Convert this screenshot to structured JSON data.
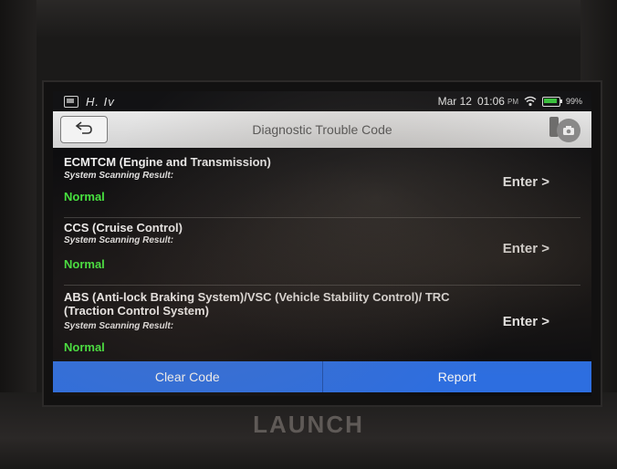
{
  "status_bar": {
    "handwriting": "H. Iv",
    "date": "Mar 12",
    "time": "01:06",
    "ampm": "PM",
    "battery": "99%"
  },
  "header": {
    "title": "Diagnostic Trouble Code"
  },
  "systems": [
    {
      "title": "ECMTCM (Engine and Transmission)",
      "subtitle": "System Scanning Result:",
      "status": "Normal",
      "action": "Enter >"
    },
    {
      "title": "CCS (Cruise Control)",
      "subtitle": "System Scanning Result:",
      "status": "Normal",
      "action": "Enter >"
    },
    {
      "title": "ABS (Anti-lock Braking System)/VSC (Vehicle Stability Control)/ TRC (Traction Control System)",
      "subtitle": "System Scanning Result:",
      "status": "Normal",
      "action": "Enter >"
    }
  ],
  "footer": {
    "clear_code": "Clear Code",
    "report": "Report"
  },
  "device": {
    "brand": "LAUNCH"
  },
  "colors": {
    "accent": "#2d6ee0",
    "status_ok": "#43e63d"
  },
  "icons": {
    "back": "back-arrow-icon",
    "camera": "camera-icon",
    "wifi": "wifi-icon",
    "battery": "battery-icon"
  }
}
